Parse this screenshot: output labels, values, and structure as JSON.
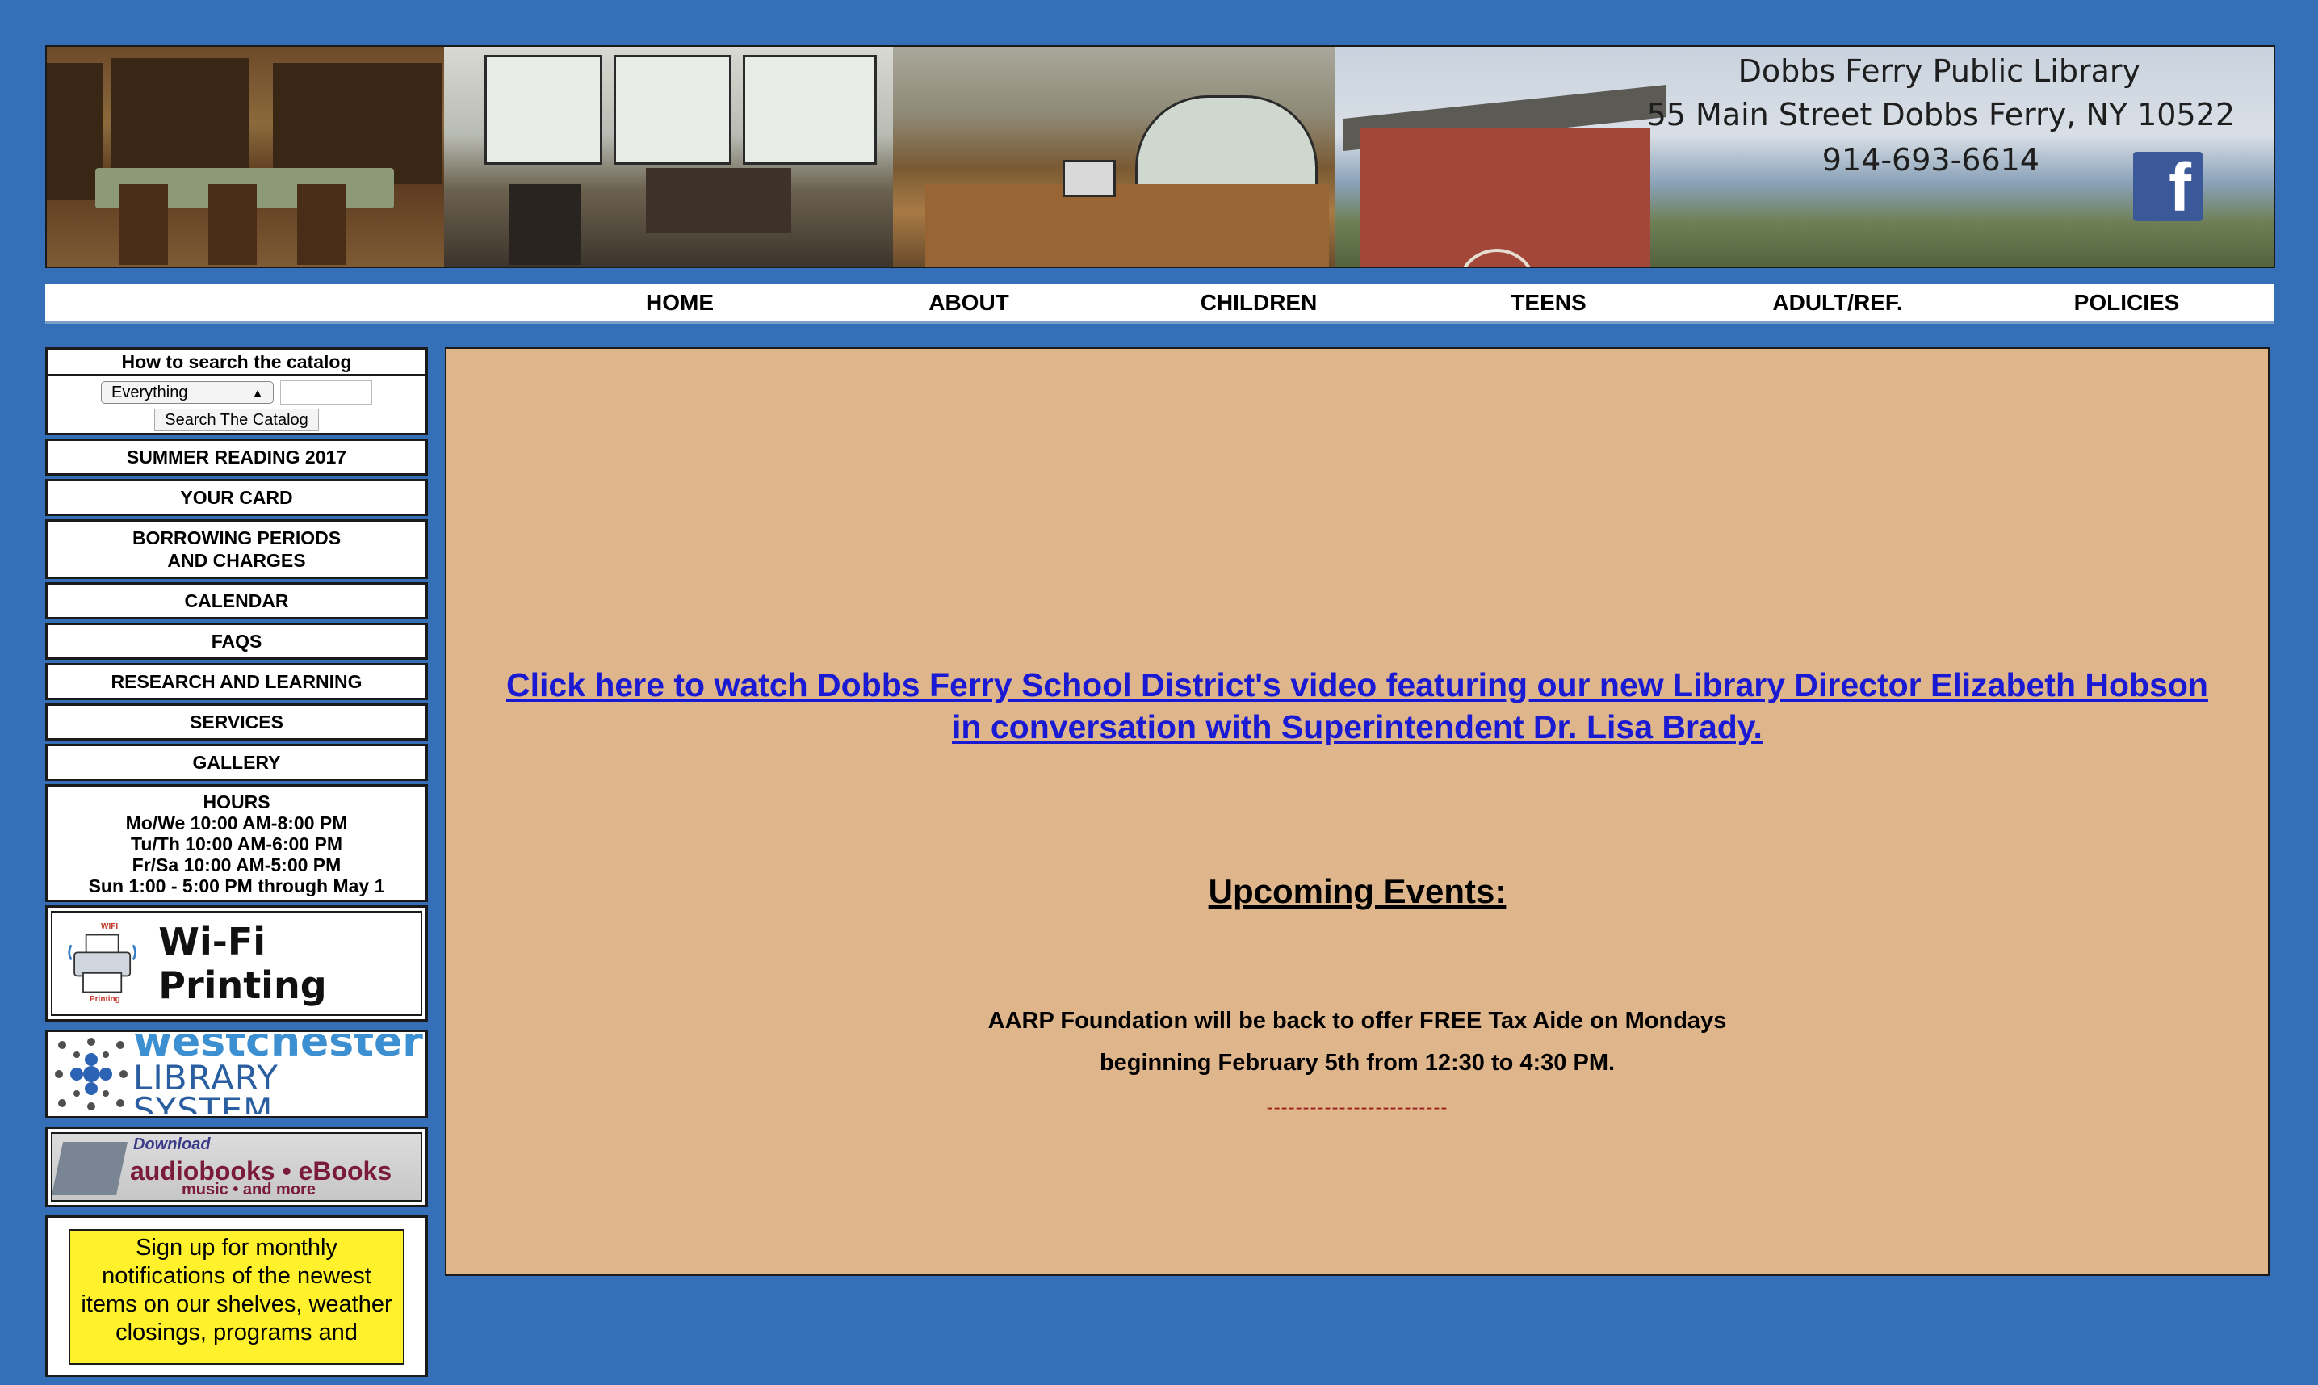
{
  "banner": {
    "library_name": "Dobbs Ferry Public Library",
    "address": "55 Main Street Dobbs Ferry, NY 10522",
    "phone": "914-693-6614",
    "facebook_icon": "facebook-icon",
    "facebook_glyph": "f"
  },
  "nav": {
    "items": [
      "HOME",
      "ABOUT",
      "CHILDREN",
      "TEENS",
      "ADULT/REF.",
      "POLICIES"
    ]
  },
  "sidebar": {
    "catalog": {
      "title": "How to search the catalog",
      "select_value": "Everything",
      "search_value": "",
      "button_label": "Search The Catalog"
    },
    "links": [
      "SUMMER READING 2017",
      "YOUR CARD",
      "BORROWING PERIODS",
      "AND CHARGES",
      "CALENDAR",
      "FAQS",
      "RESEARCH AND LEARNING",
      "SERVICES",
      "GALLERY"
    ],
    "hours": {
      "title": "HOURS",
      "lines": [
        "Mo/We 10:00 AM-8:00 PM",
        "Tu/Th 10:00 AM-6:00 PM",
        "Fr/Sa 10:00 AM-5:00 PM",
        "Sun 1:00 - 5:00 PM through May 1"
      ]
    },
    "wifi_printing": {
      "label": "Wi-Fi Printing",
      "printer_badge": "WIFI",
      "printer_tray": "Printing"
    },
    "westchester": {
      "line1": "westchester",
      "line2": "LIBRARY SYSTEM"
    },
    "audiobooks": {
      "download": "Download",
      "main": "audiobooks • eBooks",
      "sub": "music  •  and more"
    },
    "signup": {
      "lines": [
        "Sign up for monthly",
        "notifications of the newest",
        "items on our shelves, weather",
        "closings, programs and"
      ]
    }
  },
  "main": {
    "video_link_line1": "Click here to watch Dobbs Ferry School District's video featuring our new Library Director Elizabeth Hobson",
    "video_link_line2": "in conversation with Superintendent Dr. Lisa Brady.",
    "events_heading": "Upcoming Events:",
    "event_line1": "AARP Foundation will be back to offer FREE Tax Aide on Mondays",
    "event_line2": "beginning February 5th from 12:30 to 4:30 PM.",
    "separator": "-------------------------"
  },
  "colors": {
    "page_background": "#356fb8",
    "content_background": "#dfb68c",
    "link": "#1a1ad2",
    "signup_highlight": "#fff22d"
  }
}
